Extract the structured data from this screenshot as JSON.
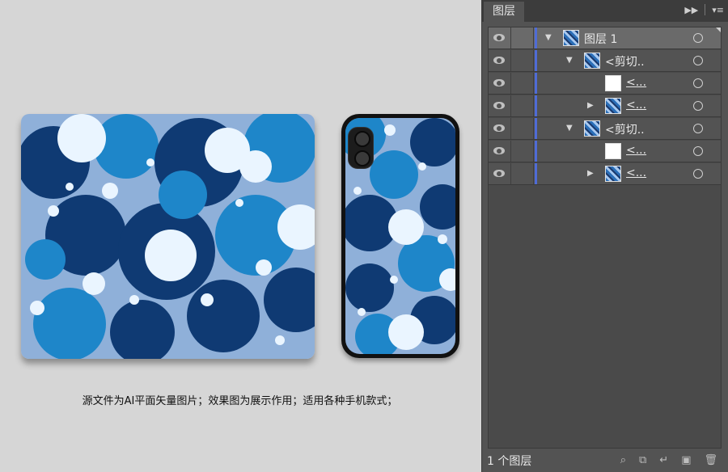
{
  "preview": {
    "caption": "源文件为AI平面矢量图片；效果图为展示作用；适用各种手机款式；"
  },
  "layers_panel": {
    "tab_label": "图层",
    "rows": [
      {
        "label": "图层 1",
        "indent": 0,
        "expander": "down",
        "thumb": "pattern",
        "selected": true
      },
      {
        "label": "<剪切..",
        "indent": 1,
        "expander": "down",
        "thumb": "pattern",
        "selected": false
      },
      {
        "label": "<...",
        "indent": 2,
        "expander": "",
        "thumb": "clip",
        "selected": false
      },
      {
        "label": "<...",
        "indent": 2,
        "expander": "right",
        "thumb": "pattern",
        "selected": false
      },
      {
        "label": "<剪切..",
        "indent": 1,
        "expander": "down",
        "thumb": "pattern",
        "selected": false
      },
      {
        "label": "<...",
        "indent": 2,
        "expander": "",
        "thumb": "clip",
        "selected": false
      },
      {
        "label": "<...",
        "indent": 2,
        "expander": "right",
        "thumb": "pattern",
        "selected": false
      }
    ],
    "footer_label": "1 个图层",
    "footer_icons": [
      "search-icon",
      "make-clip-icon",
      "new-sublayer-icon",
      "new-layer-icon",
      "delete-icon"
    ]
  },
  "colors": {
    "navy": "#0f3a73",
    "mid_blue": "#1e86c9",
    "light_blue": "#8fb0d9",
    "white_splash": "#eaf5ff",
    "layer_accent": "#4f6cd6"
  }
}
